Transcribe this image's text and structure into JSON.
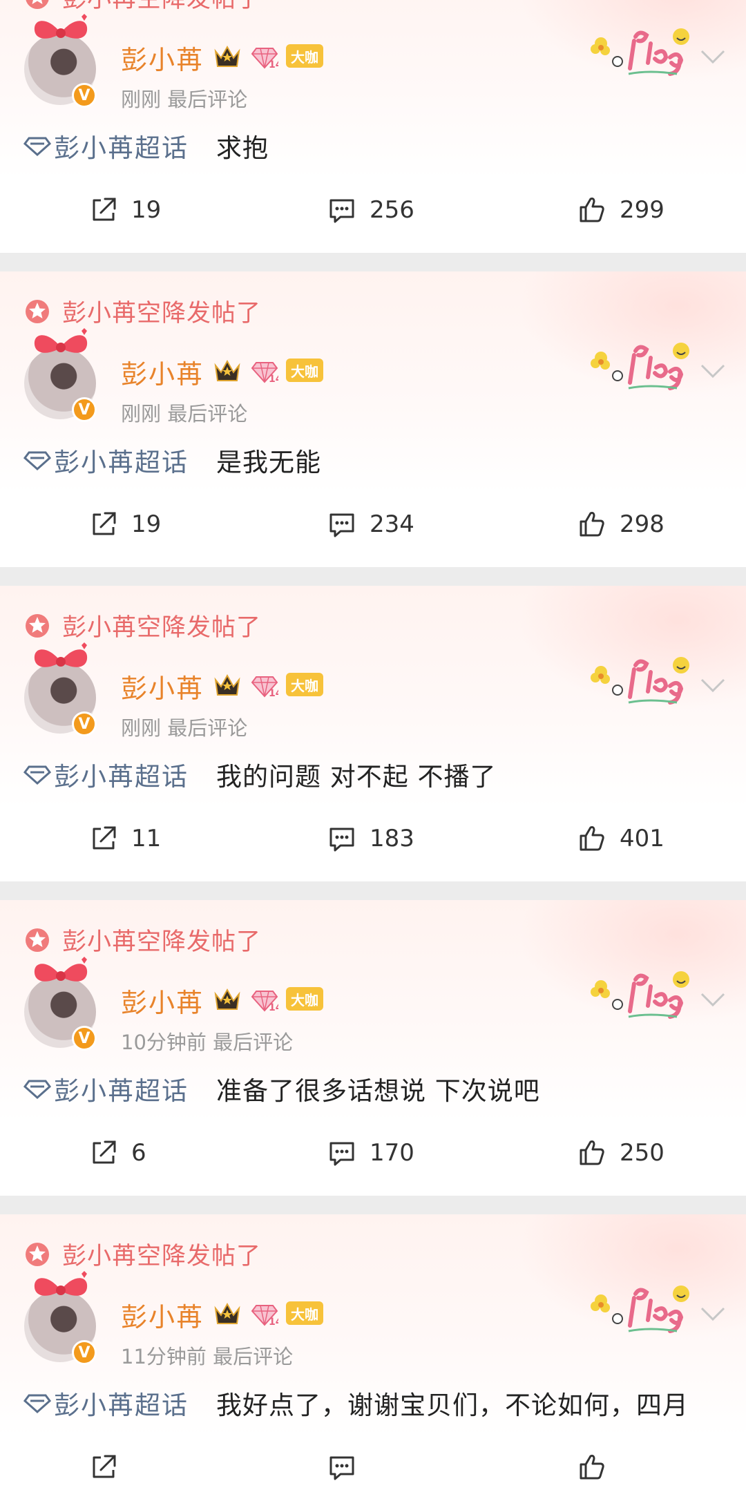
{
  "colors": {
    "airdrop_text": "#e86a6a",
    "username": "#e8832a",
    "topic": "#5a6f8c",
    "badge_vip": "#f7c23a",
    "verified": "#f39a1c"
  },
  "icons": {
    "airdrop": "red-star-icon",
    "crown": "crown-icon",
    "fan_level": "diamond-level-icon",
    "verified": "verified-v-icon",
    "topic": "diamond-outline-icon",
    "decoration": "plog-sticker",
    "menu": "chevron-down-icon",
    "share": "share-icon",
    "comment": "comment-icon",
    "like": "thumbs-up-icon"
  },
  "posts": [
    {
      "airdrop": "彭小苒空降发帖了",
      "username": "彭小苒",
      "fan_level": "14",
      "badge": "大咖",
      "verified": "V",
      "time": "刚刚",
      "meta_suffix": "最后评论",
      "topic": "彭小苒超话",
      "text": "求抱",
      "shares": "19",
      "comments": "256",
      "likes": "299"
    },
    {
      "airdrop": "彭小苒空降发帖了",
      "username": "彭小苒",
      "fan_level": "14",
      "badge": "大咖",
      "verified": "V",
      "time": "刚刚",
      "meta_suffix": "最后评论",
      "topic": "彭小苒超话",
      "text": "是我无能",
      "shares": "19",
      "comments": "234",
      "likes": "298"
    },
    {
      "airdrop": "彭小苒空降发帖了",
      "username": "彭小苒",
      "fan_level": "14",
      "badge": "大咖",
      "verified": "V",
      "time": "刚刚",
      "meta_suffix": "最后评论",
      "topic": "彭小苒超话",
      "text": "我的问题 对不起 不播了",
      "shares": "11",
      "comments": "183",
      "likes": "401"
    },
    {
      "airdrop": "彭小苒空降发帖了",
      "username": "彭小苒",
      "fan_level": "14",
      "badge": "大咖",
      "verified": "V",
      "time": "10分钟前",
      "meta_suffix": "最后评论",
      "topic": "彭小苒超话",
      "text": "准备了很多话想说 下次说吧",
      "shares": "6",
      "comments": "170",
      "likes": "250"
    },
    {
      "airdrop": "彭小苒空降发帖了",
      "username": "彭小苒",
      "fan_level": "14",
      "badge": "大咖",
      "verified": "V",
      "time": "11分钟前",
      "meta_suffix": "最后评论",
      "topic": "彭小苒超话",
      "text": "我好点了，谢谢宝贝们，不论如何，四月",
      "shares": "",
      "comments": "",
      "likes": ""
    }
  ]
}
